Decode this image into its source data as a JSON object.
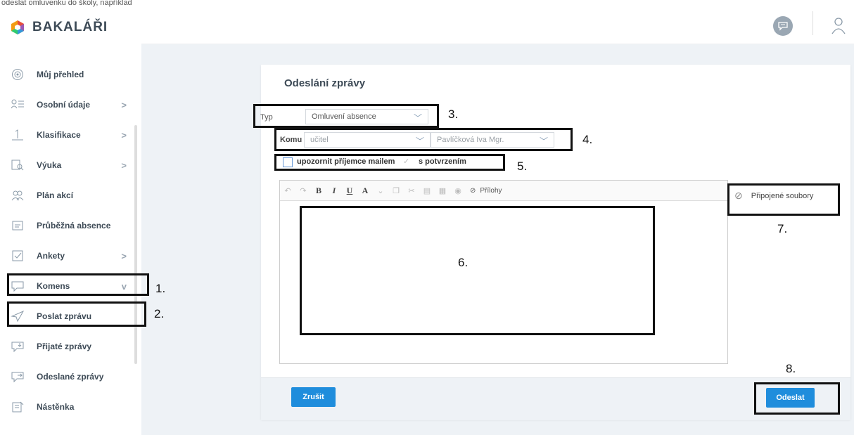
{
  "top_strip_text": "odeslat omluvenku do školy, například",
  "app": {
    "name": "BAKALÁŘI"
  },
  "sidebar": {
    "items": [
      {
        "label": "Můj přehled",
        "icon": "target-icon",
        "chevron": ""
      },
      {
        "label": "Osobní údaje",
        "icon": "person-list-icon",
        "chevron": ">"
      },
      {
        "label": "Klasifikace",
        "icon": "grade-one-icon",
        "chevron": ">"
      },
      {
        "label": "Výuka",
        "icon": "book-search-icon",
        "chevron": ">"
      },
      {
        "label": "Plán akcí",
        "icon": "people-icon",
        "chevron": ""
      },
      {
        "label": "Průběžná absence",
        "icon": "absence-icon",
        "chevron": ""
      },
      {
        "label": "Ankety",
        "icon": "checkbox-icon",
        "chevron": ">"
      },
      {
        "label": "Komens",
        "icon": "chat-icon",
        "chevron": "v"
      },
      {
        "label": "Poslat zprávu",
        "icon": "send-icon",
        "chevron": ""
      },
      {
        "label": "Přijaté zprávy",
        "icon": "inbox-icon",
        "chevron": ""
      },
      {
        "label": "Odeslané zprávy",
        "icon": "outbox-icon",
        "chevron": ""
      },
      {
        "label": "Nástěnka",
        "icon": "board-icon",
        "chevron": ""
      }
    ]
  },
  "form": {
    "title": "Odeslání zprávy",
    "type_label": "Typ",
    "type_value": "Omluvení absence",
    "to_label": "Komu",
    "to_role": "učitel",
    "to_person": "Pavlíčková Iva Mgr.",
    "notify_label": "upozornit příjemce mailem",
    "confirm_label": "s potvrzením",
    "toolbar": {
      "bold": "B",
      "italic": "I",
      "underline": "U",
      "font": "A",
      "attachments": "Přílohy"
    },
    "attached_files_label": "Připojené soubory",
    "cancel_label": "Zrušit",
    "send_label": "Odeslat"
  },
  "annotations": [
    "1.",
    "2.",
    "3.",
    "4.",
    "5.",
    "6.",
    "7.",
    "8."
  ],
  "colors": {
    "accent": "#1f8ddc",
    "sidebar_text": "#3d4a56",
    "background": "#eef2f6"
  }
}
